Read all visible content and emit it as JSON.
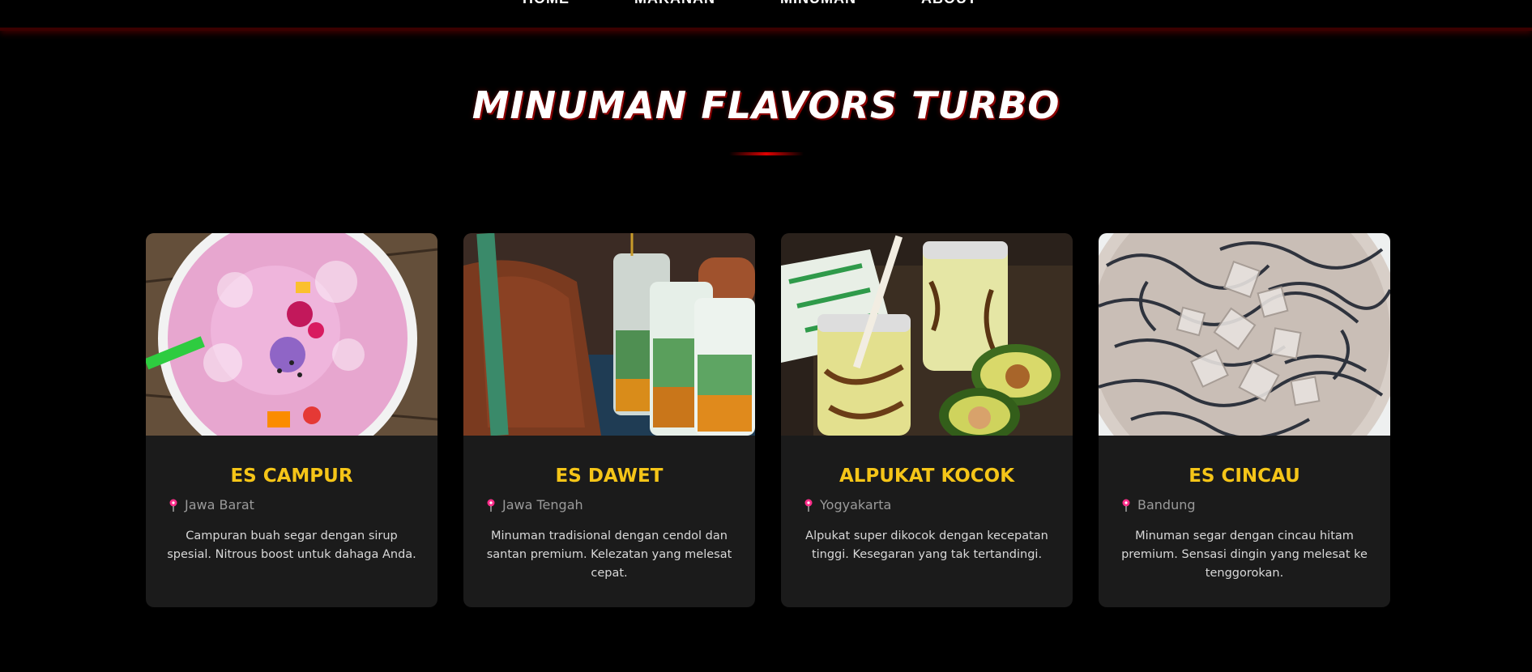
{
  "nav": {
    "items": [
      "HOME",
      "MAKANAN",
      "MINUMAN",
      "ABOUT"
    ]
  },
  "section": {
    "title": "MINUMAN FLAVORS TURBO"
  },
  "colors": {
    "accent_red": "#e00000",
    "card_title": "#f5c518",
    "pin": "#ff2d8a"
  },
  "cards": [
    {
      "name": "ES CAMPUR",
      "location": "Jawa Barat",
      "description": "Campuran buah segar dengan sirup spesial. Nitrous boost untuk dahaga Anda.",
      "icon": "location-pin-icon"
    },
    {
      "name": "ES DAWET",
      "location": "Jawa Tengah",
      "description": "Minuman tradisional dengan cendol dan santan premium. Kelezatan yang melesat cepat.",
      "icon": "location-pin-icon"
    },
    {
      "name": "ALPUKAT KOCOK",
      "location": "Yogyakarta",
      "description": "Alpukat super dikocok dengan kecepatan tinggi. Kesegaran yang tak tertandingi.",
      "icon": "location-pin-icon"
    },
    {
      "name": "ES CINCAU",
      "location": "Bandung",
      "description": "Minuman segar dengan cincau hitam premium. Sensasi dingin yang melesat ke tenggorokan.",
      "icon": "location-pin-icon"
    }
  ]
}
